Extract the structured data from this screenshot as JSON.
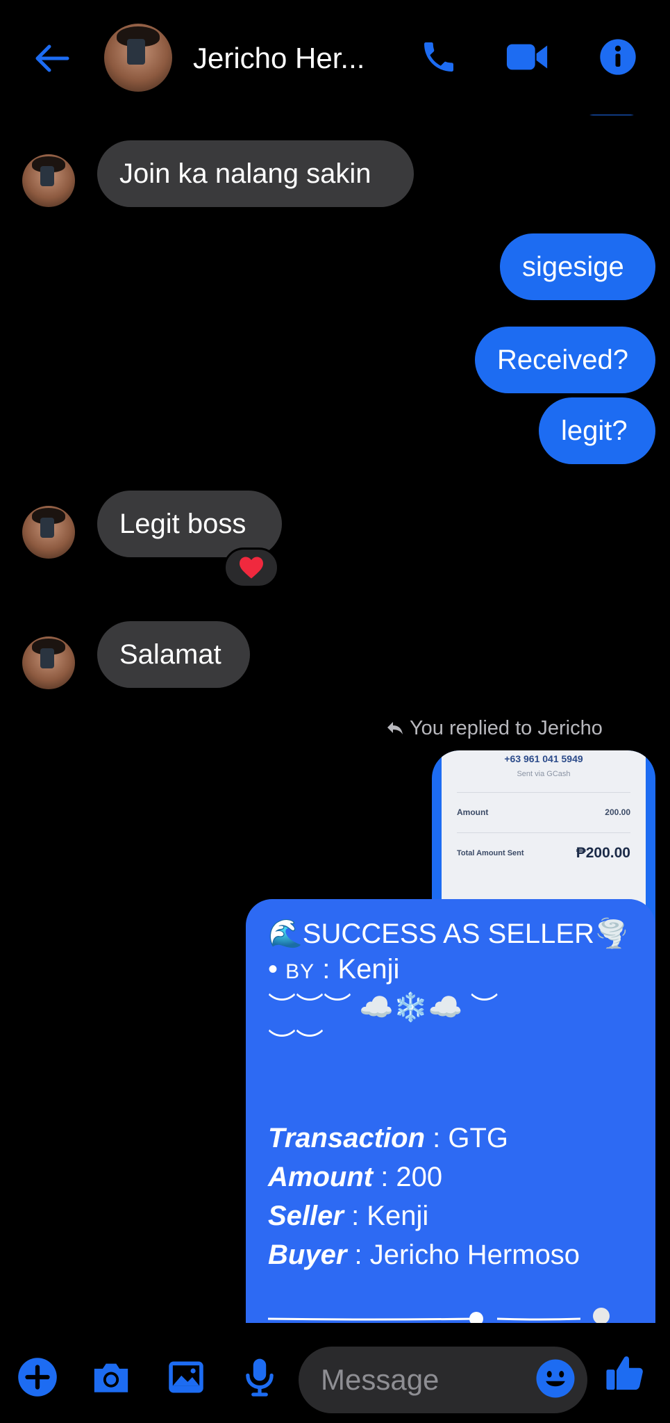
{
  "header": {
    "contact_name": "Jericho Her...",
    "icons": [
      "back-arrow-icon",
      "phone-icon",
      "video-camera-icon",
      "info-icon"
    ],
    "accent_color": "#1d6cf2"
  },
  "messages": {
    "join": "Join ka nalang sakin",
    "sigesige": "sigesige",
    "received": "Received?",
    "legit_q": "legit?",
    "legit_boss": "Legit boss",
    "legit_reaction": "❤️",
    "salamat": "Salamat",
    "reply_label": "You replied to Jericho"
  },
  "receipt": {
    "number": "+63 961 041 5949",
    "via": "Sent via GCash",
    "amount_label": "Amount",
    "amount_value": "200.00",
    "total_label": "Total Amount Sent",
    "total_value": "₱200.00"
  },
  "card": {
    "title": "🌊SUCCESS AS SELLER🌪️",
    "by_prefix": "• ",
    "by_label": "BY",
    "by_value": " : Kenji",
    "deco1": "︶︶︶ ☁️❄️☁️ ︶",
    "deco2": "︶︶",
    "transaction_label": "Transaction",
    "transaction_value": " : GTG",
    "amount_label": "Amount",
    "amount_value": " : 200",
    "seller_label": "Seller",
    "seller_value": " : Kenji",
    "buyer_label": "Buyer",
    "buyer_value": " : Jericho Hermoso"
  },
  "composer": {
    "placeholder": "Message",
    "icons": [
      "plus-icon",
      "camera-icon",
      "gallery-icon",
      "microphone-icon",
      "emoji-icon",
      "thumbs-up-icon"
    ]
  }
}
